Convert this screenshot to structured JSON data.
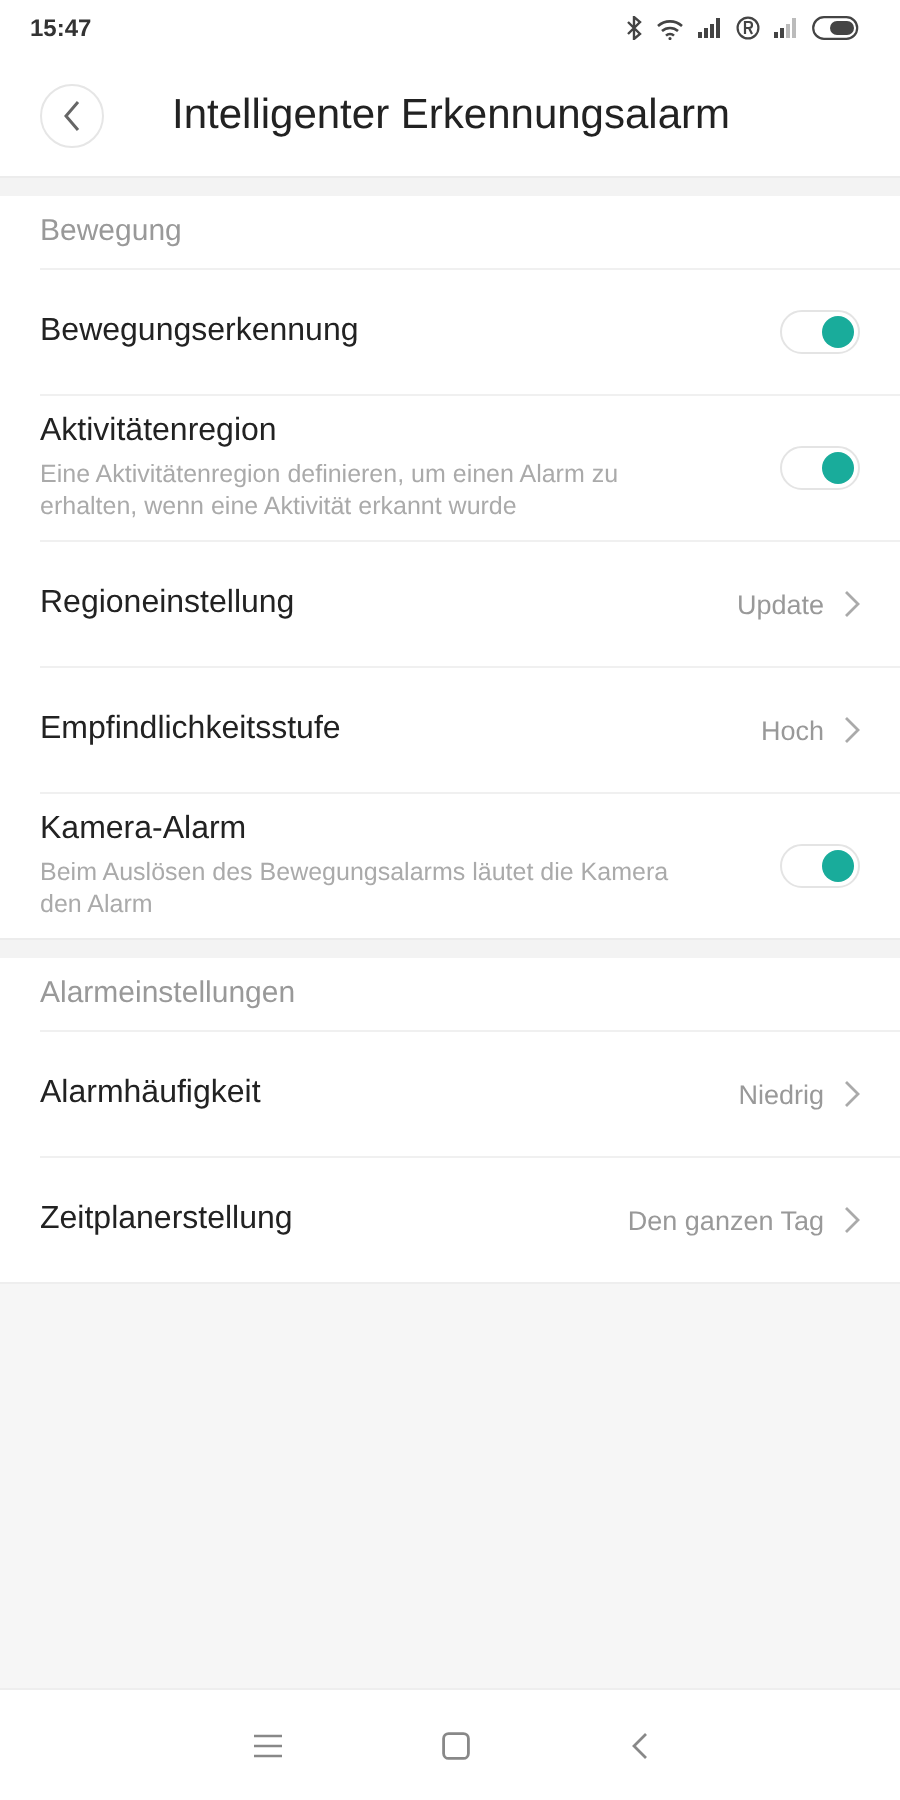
{
  "status_bar": {
    "time": "15:47"
  },
  "header": {
    "title": "Intelligenter Erkennungsalarm"
  },
  "sections": [
    {
      "title": "Bewegung",
      "rows": [
        {
          "kind": "toggle",
          "label": "Bewegungserkennung",
          "on": true
        },
        {
          "kind": "toggle",
          "label": "Aktivitätenregion",
          "description": "Eine Aktivitätenregion definieren, um einen Alarm zu erhalten, wenn eine Aktivität erkannt wurde",
          "on": true
        },
        {
          "kind": "link",
          "label": "Regioneinstellung",
          "value": "Update"
        },
        {
          "kind": "link",
          "label": "Empfindlichkeitsstufe",
          "value": "Hoch"
        },
        {
          "kind": "toggle",
          "label": "Kamera-Alarm",
          "description": "Beim Auslösen des Bewegungsalarms läutet die Kamera den Alarm",
          "on": true
        }
      ]
    },
    {
      "title": "Alarmeinstellungen",
      "rows": [
        {
          "kind": "link",
          "label": "Alarmhäufigkeit",
          "value": "Niedrig"
        },
        {
          "kind": "link",
          "label": "Zeitplanerstellung",
          "value": "Den ganzen Tag"
        }
      ]
    }
  ]
}
